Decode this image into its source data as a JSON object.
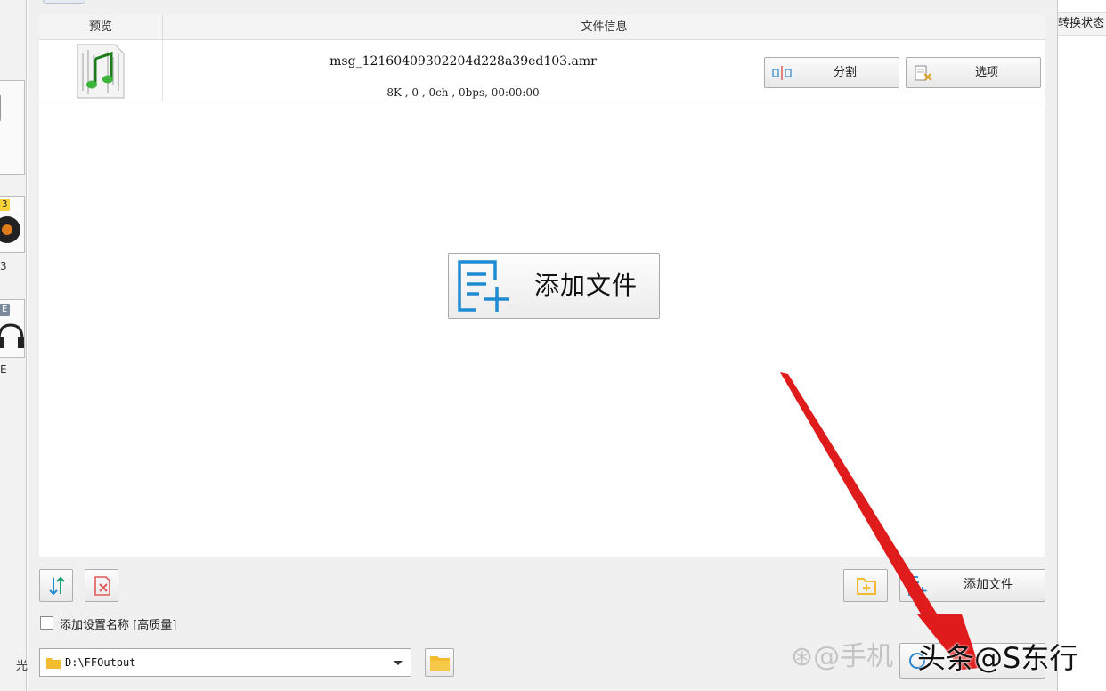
{
  "background_app": {
    "left_badges": [
      "3",
      "E"
    ],
    "left_labels": [
      "3",
      "E"
    ],
    "left_bottom_text": "光",
    "right_status_header": "转换状态"
  },
  "list": {
    "header_preview": "预览",
    "header_info": "文件信息",
    "file": {
      "name": "msg_12160409302204d228a39ed103.amr",
      "meta": "8K , 0 , 0ch , 0bps, 00:00:00"
    },
    "split_label": "分割",
    "options_label": "选项"
  },
  "center_add_label": "添加文件",
  "bottom": {
    "add_file_label": "添加文件",
    "checkbox_label": "添加设置名称 [高质量]",
    "checkbox_checked": false,
    "output_folder": "D:\\FFOutput"
  },
  "overlay": {
    "watermark_small": "⊛@手机",
    "watermark_big": "头条@S东行"
  },
  "icons": {
    "thumb": "music-file-icon",
    "split": "split-icon",
    "options": "options-icon",
    "center_add": "add-file-icon",
    "sort": "sort-icon",
    "remove": "remove-file-icon",
    "add_folder": "add-folder-icon",
    "folder": "folder-icon"
  },
  "colors": {
    "accent_blue": "#1f8bd2",
    "arrow_red": "#e01b1b",
    "folder_yellow": "#f2bb30"
  }
}
